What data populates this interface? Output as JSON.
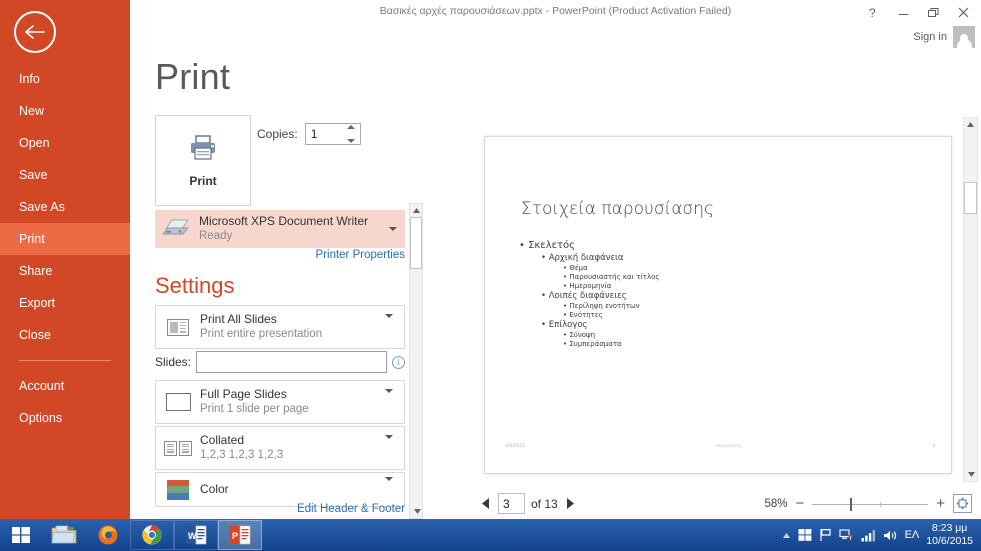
{
  "window": {
    "title": "Βασικές αρχές παρουσιάσεων.pptx - PowerPoint (Product Activation Failed)",
    "help_icon": "help-icon",
    "minimize_icon": "minimize-icon",
    "restore_icon": "restore-icon",
    "close_icon": "close-icon",
    "sign_in_label": "Sign in",
    "avatar_icon": "user-avatar-icon"
  },
  "backstage": {
    "back_icon": "back-arrow-icon",
    "accent_color": "#d24726",
    "selected_color": "#ed6a45",
    "items": [
      {
        "label": "Info",
        "selected": false
      },
      {
        "label": "New",
        "selected": false
      },
      {
        "label": "Open",
        "selected": false
      },
      {
        "label": "Save",
        "selected": false
      },
      {
        "label": "Save As",
        "selected": false
      },
      {
        "label": "Print",
        "selected": true
      },
      {
        "label": "Share",
        "selected": false
      },
      {
        "label": "Export",
        "selected": false
      },
      {
        "label": "Close",
        "selected": false
      }
    ],
    "items_after_divider": [
      {
        "label": "Account"
      },
      {
        "label": "Options"
      }
    ]
  },
  "page": {
    "title": "Print"
  },
  "print": {
    "print_button_label": "Print",
    "print_icon": "printer-icon",
    "copies_label": "Copies:",
    "copies_value": "1",
    "spin_up_icon": "spin-up-icon",
    "spin_down_icon": "spin-down-icon",
    "printer_icon": "printer-device-icon",
    "printer_name": "Microsoft XPS Document Writer",
    "printer_status": "Ready",
    "printer_dropdown_icon": "chevron-down-icon",
    "printer_properties_label": "Printer Properties"
  },
  "settings": {
    "heading": "Settings",
    "rows": [
      {
        "icon": "print-range-icon",
        "primary": "Print All Slides",
        "secondary": "Print entire presentation",
        "dropdown_icon": "chevron-down-icon"
      },
      {
        "icon": "full-page-slides-icon",
        "primary": "Full Page Slides",
        "secondary": "Print 1 slide per page",
        "dropdown_icon": "chevron-down-icon"
      },
      {
        "icon": "collated-icon",
        "primary": "Collated",
        "secondary": "1,2,3   1,2,3   1,2,3",
        "dropdown_icon": "chevron-down-icon"
      },
      {
        "icon": "color-icon",
        "primary": "Color",
        "secondary": "",
        "dropdown_icon": "chevron-down-icon"
      }
    ],
    "slides_label": "Slides:",
    "slides_value": "",
    "slides_placeholder": "",
    "slides_info_icon": "info-icon",
    "edit_header_footer_label": "Edit Header & Footer",
    "color_bands": [
      "#d2593a",
      "#73a387",
      "#4a7bb5"
    ]
  },
  "preview": {
    "slide": {
      "title": "Στοιχεία παρουσίασης",
      "bullets": [
        {
          "level": 1,
          "text": "Σκελετός"
        },
        {
          "level": 2,
          "text": "Αρχική διαφάνεια"
        },
        {
          "level": 3,
          "text": "Θέμα"
        },
        {
          "level": 3,
          "text": "Παρουσιαστής και τίτλος"
        },
        {
          "level": 3,
          "text": "Ημερομηνία"
        },
        {
          "level": 2,
          "text": "Λοιπές διαφάνειες"
        },
        {
          "level": 3,
          "text": "Περίληψη ενοτήτων"
        },
        {
          "level": 3,
          "text": "Ενότητες"
        },
        {
          "level": 2,
          "text": "Επίλογος"
        },
        {
          "level": 3,
          "text": "Σύνοψη"
        },
        {
          "level": 3,
          "text": "Συμπεράσματα"
        }
      ],
      "footer_left": "4/6/2015",
      "footer_center": "παρουσίαση",
      "footer_right": "3"
    },
    "nav": {
      "prev_icon": "previous-slide-icon",
      "next_icon": "next-slide-icon",
      "current_page": "3",
      "of_label": "of 13",
      "zoom_percent": "58%",
      "zoom_out_icon": "zoom-out-icon",
      "zoom_in_icon": "zoom-in-icon",
      "fit_to_window_icon": "fit-to-window-icon"
    },
    "scroll_up_icon": "scroll-up-icon",
    "scroll_down_icon": "scroll-down-icon"
  },
  "taskbar": {
    "start_icon": "windows-start-icon",
    "items": [
      {
        "icon": "file-explorer-icon",
        "state": "pinned"
      },
      {
        "icon": "firefox-icon",
        "state": "pinned"
      },
      {
        "icon": "chrome-icon",
        "state": "pinned"
      },
      {
        "icon": "word-icon",
        "state": "pinned"
      },
      {
        "icon": "powerpoint-icon",
        "state": "active"
      }
    ],
    "tray": {
      "show_hidden_icon": "show-hidden-icons-arrow",
      "action_center_icon": "action-center-icon",
      "flag_icon": "flag-icon",
      "network_icon": "network-warning-icon",
      "signal_icon": "signal-bars-icon",
      "volume_icon": "volume-icon",
      "language": "ΕΛ",
      "time": "8:23 μμ",
      "date": "10/6/2015"
    }
  }
}
